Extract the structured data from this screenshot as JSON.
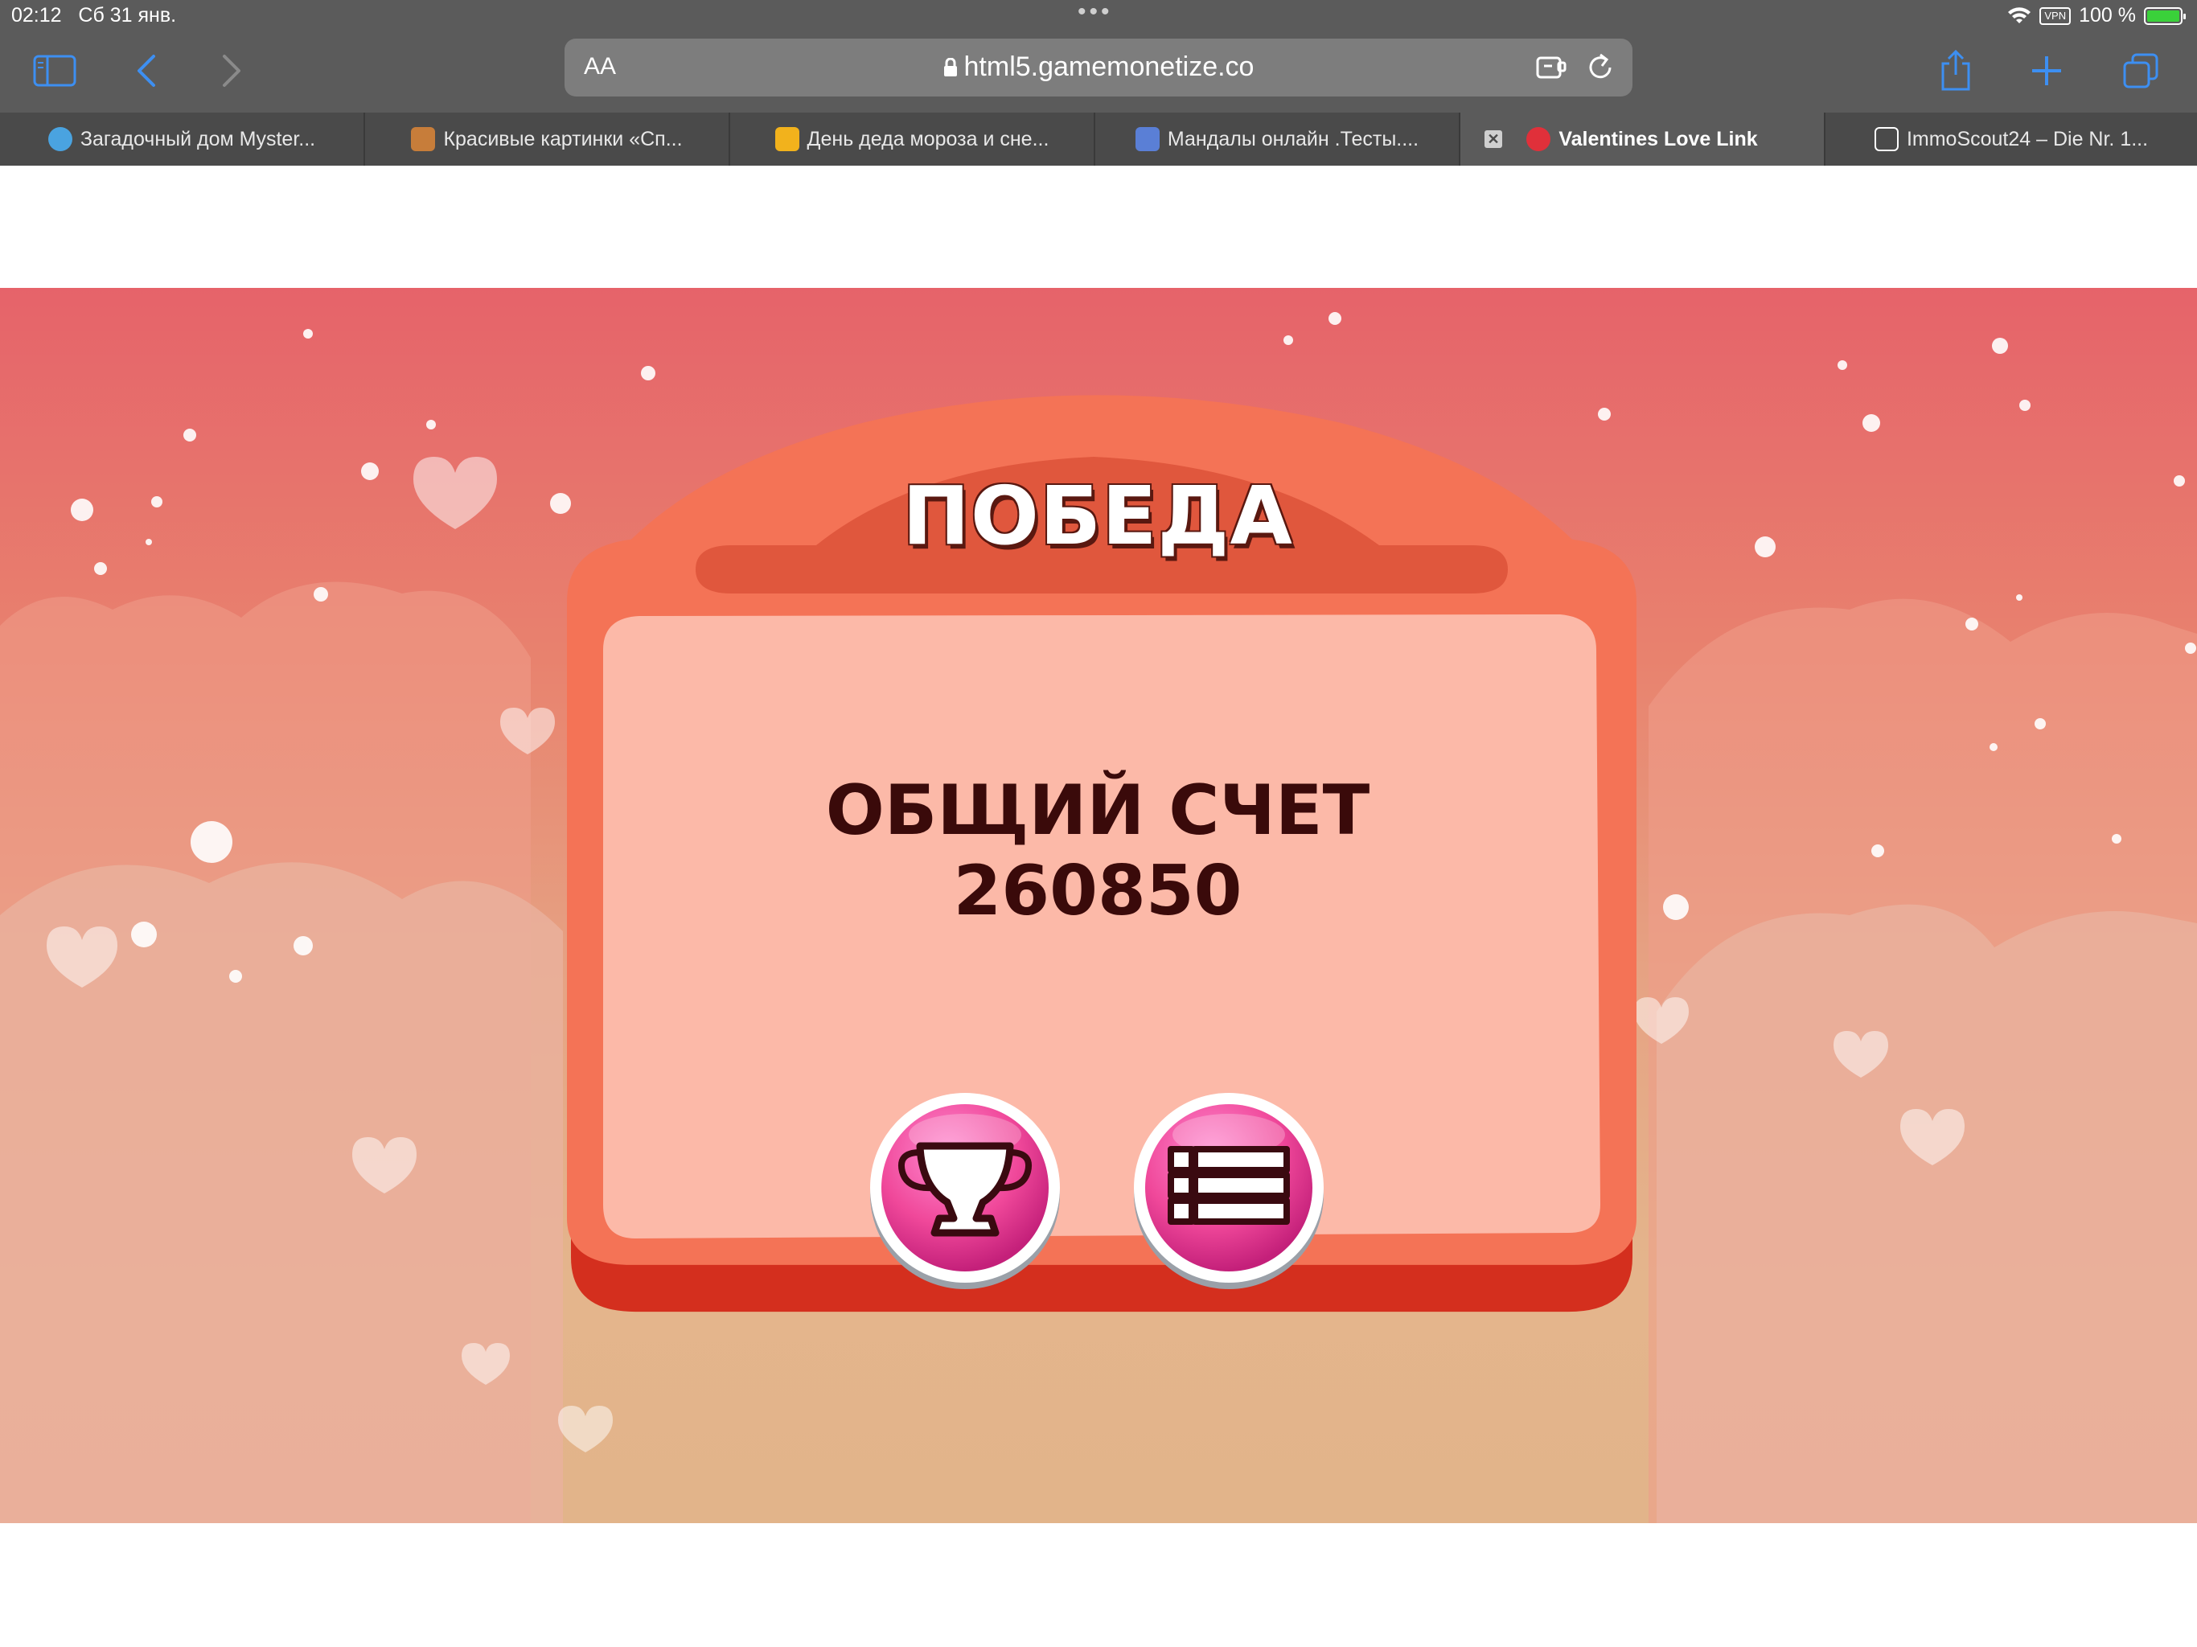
{
  "status_bar": {
    "time": "02:12",
    "date": "Сб 31 янв.",
    "vpn": "VPN",
    "battery": "100 %"
  },
  "toolbar": {
    "aa_label": "AA",
    "url": "html5.gamemonetize.co"
  },
  "tabs": [
    {
      "label": "Загадочный дом Myster...",
      "favicon_color": "#4aa3e0"
    },
    {
      "label": "Красивые картинки «Сп...",
      "favicon_color": "#c77d3a"
    },
    {
      "label": "День деда мороза и сне...",
      "favicon_color": "#f2b21c"
    },
    {
      "label": "Мандалы онлайн .Тесты....",
      "favicon_color": "#5a7fd6"
    },
    {
      "label": "Valentines Love Link",
      "favicon_color": "#e0303a",
      "active": true
    },
    {
      "label": "ImmoScout24 – Die Nr. 1...",
      "favicon_color": "#ffffff"
    }
  ],
  "game": {
    "title": "ПОБЕДА",
    "score_label": "ОБЩИЙ СЧЕТ",
    "score_value": "260850",
    "buttons": [
      {
        "icon": "trophy-icon"
      },
      {
        "icon": "list-icon"
      }
    ]
  },
  "colors": {
    "accent_blue": "#3d8ff2",
    "panel_outer": "#f47356",
    "panel_inner": "#fcb9a8",
    "title_bar": "#e0573d",
    "button_pink": "#f0489a"
  }
}
